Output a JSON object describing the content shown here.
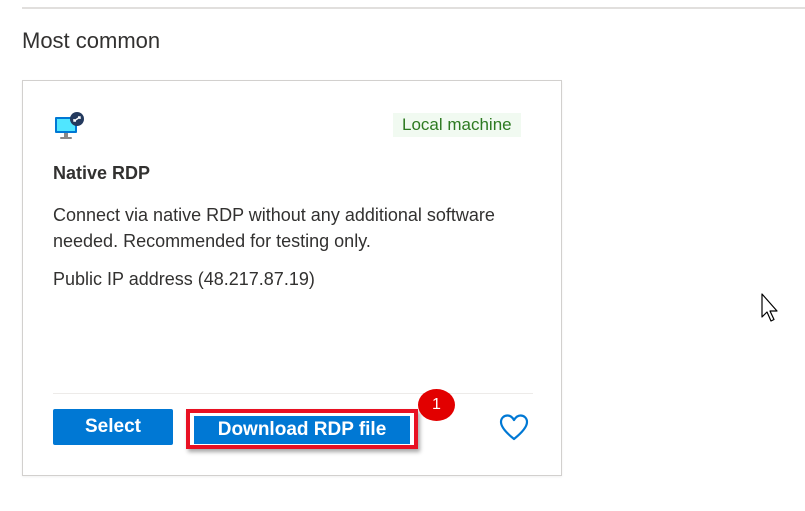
{
  "section": {
    "title": "Most common"
  },
  "card": {
    "icon": "monitor-connect-icon",
    "tag": "Local machine",
    "title": "Native RDP",
    "description": "Connect via native RDP without any additional software needed. Recommended for testing only.",
    "ip_text": "Public IP address (48.217.87.19)",
    "buttons": {
      "select": "Select",
      "download": "Download RDP file"
    },
    "favorite_icon": "heart-icon"
  },
  "annotation": {
    "step": "1"
  },
  "colors": {
    "primary": "#0078d4",
    "tag_bg": "#f1faf1",
    "tag_text": "#2d7a21",
    "highlight_border": "#e81123",
    "badge": "#e20000"
  },
  "cursor_icon": "mouse-pointer-icon"
}
